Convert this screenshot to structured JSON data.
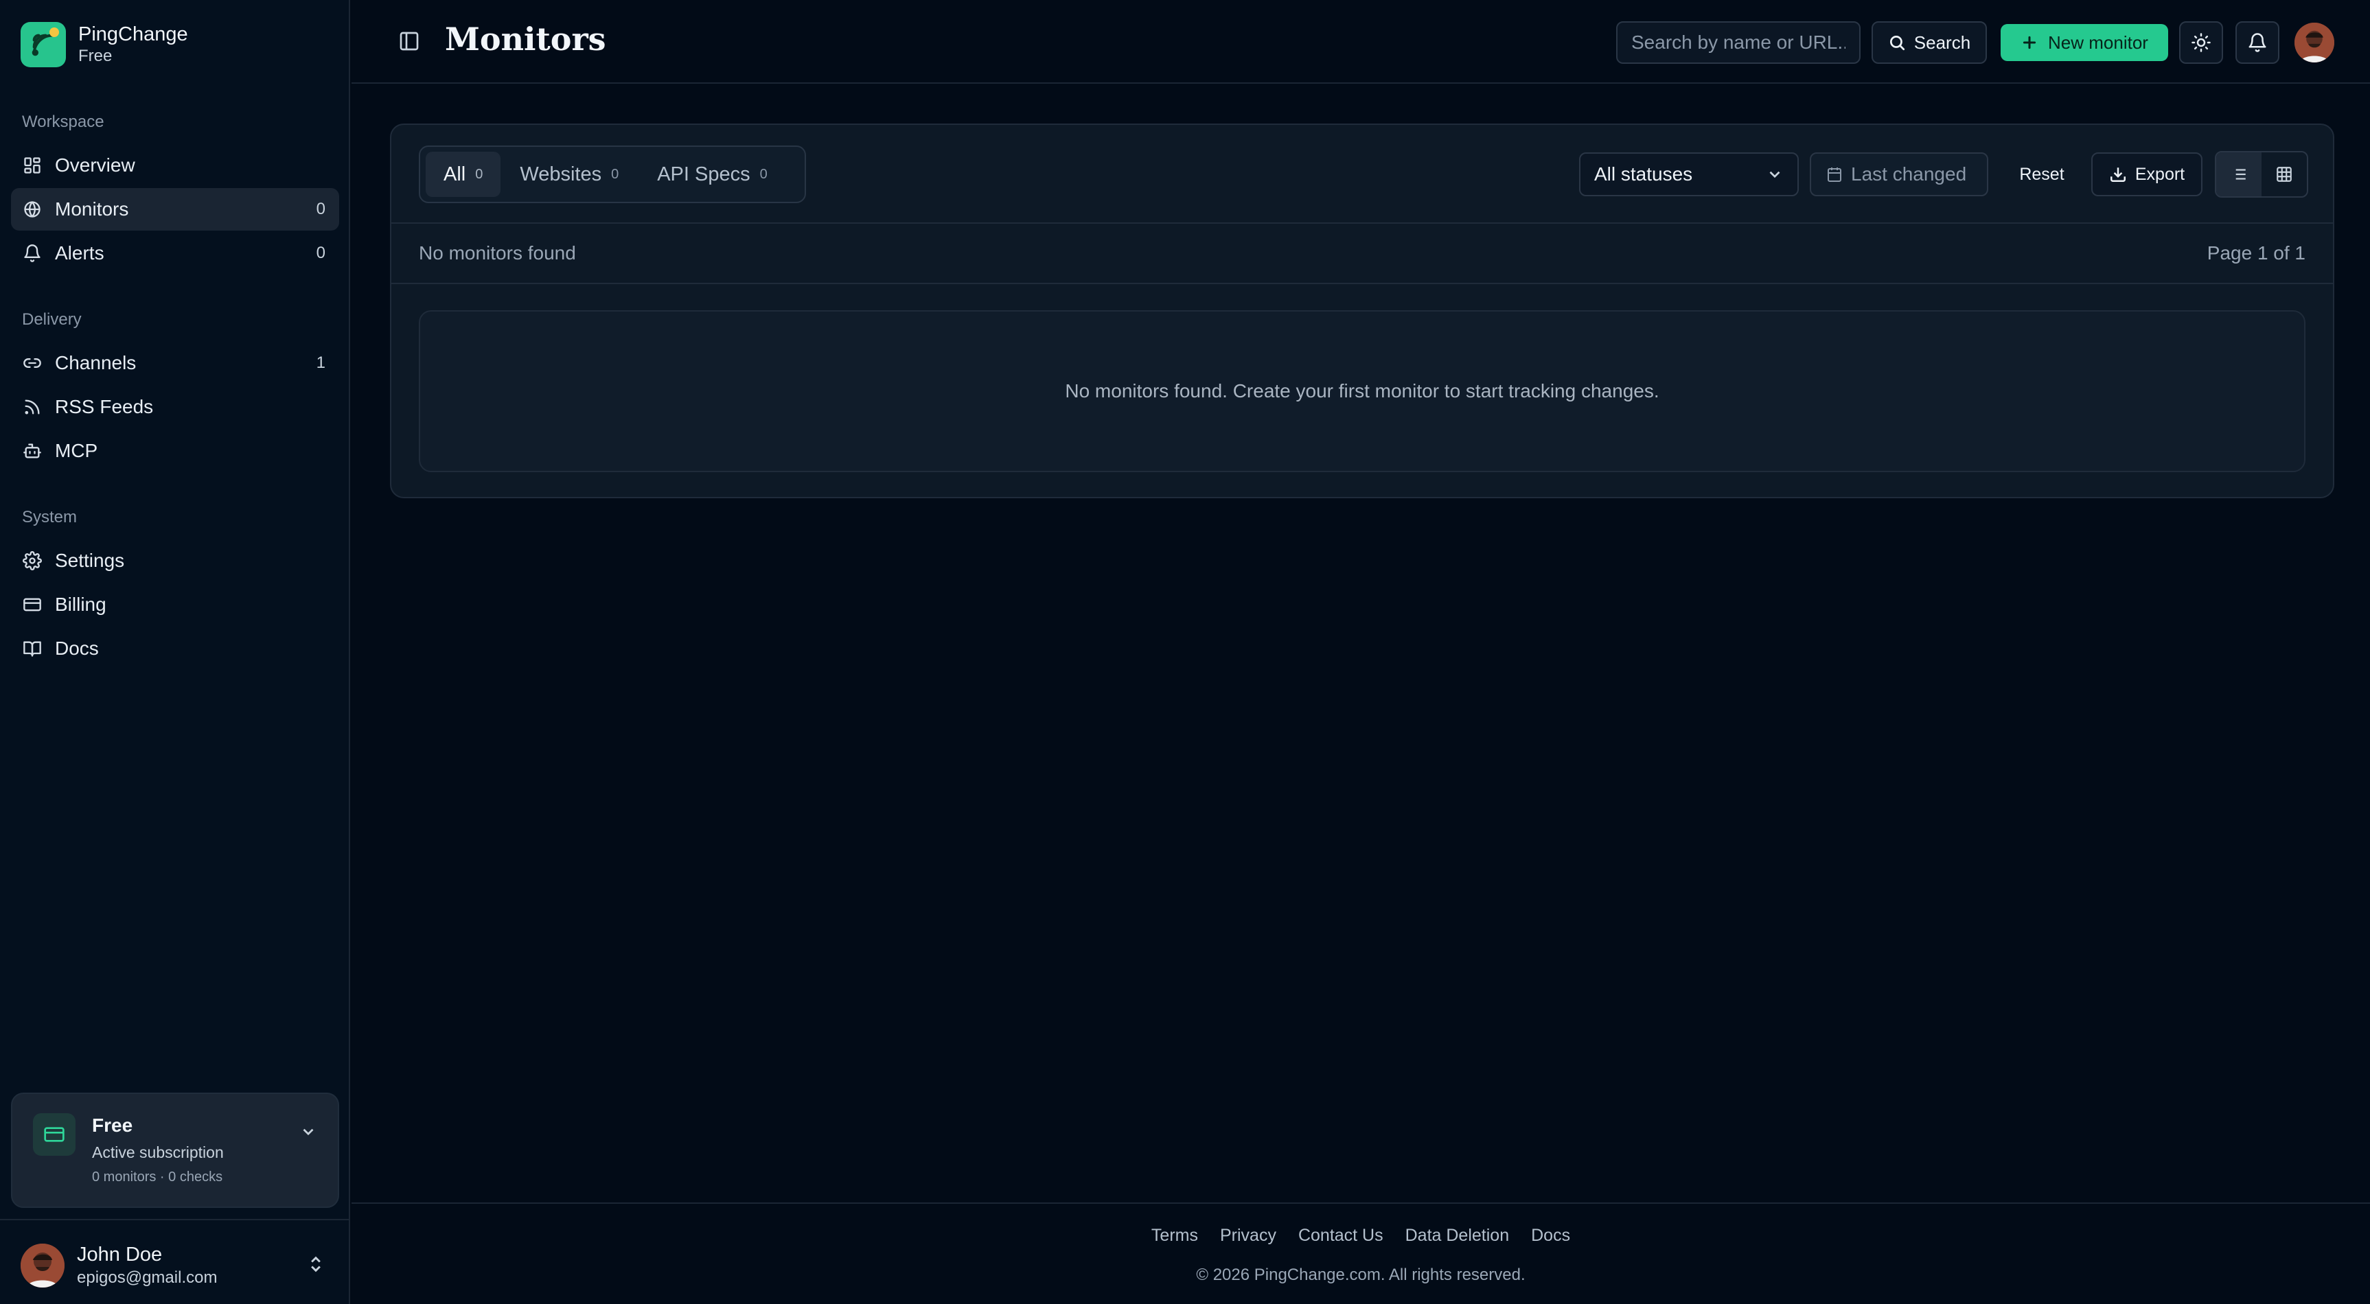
{
  "brand": {
    "name": "PingChange",
    "plan": "Free"
  },
  "sidebar": {
    "sections": [
      {
        "label": "Workspace"
      },
      {
        "label": "Delivery"
      },
      {
        "label": "System"
      }
    ],
    "items": [
      {
        "label": "Overview",
        "icon": "dashboard-icon",
        "count": ""
      },
      {
        "label": "Monitors",
        "icon": "globe-icon",
        "count": "0",
        "active": true
      },
      {
        "label": "Alerts",
        "icon": "bell-icon",
        "count": "0"
      },
      {
        "label": "Channels",
        "icon": "link-icon",
        "count": "1"
      },
      {
        "label": "RSS Feeds",
        "icon": "rss-icon",
        "count": ""
      },
      {
        "label": "MCP",
        "icon": "bot-icon",
        "count": ""
      },
      {
        "label": "Settings",
        "icon": "gear-icon",
        "count": ""
      },
      {
        "label": "Billing",
        "icon": "credit-card-icon",
        "count": ""
      },
      {
        "label": "Docs",
        "icon": "book-icon",
        "count": ""
      }
    ],
    "plan_card": {
      "title": "Free",
      "subtitle": "Active subscription",
      "meta": "0 monitors · 0 checks"
    },
    "user": {
      "name": "John Doe",
      "email": "epigos@gmail.com"
    }
  },
  "header": {
    "title": "Monitors",
    "search_placeholder": "Search by name or URL...",
    "search_label": "Search",
    "new_monitor_label": "New monitor"
  },
  "main": {
    "tabs": [
      {
        "label": "All",
        "count": "0",
        "active": true
      },
      {
        "label": "Websites",
        "count": "0"
      },
      {
        "label": "API Specs",
        "count": "0"
      }
    ],
    "status_filter": "All statuses",
    "date_filter": "Last changed",
    "reset_label": "Reset",
    "export_label": "Export",
    "summary": "No monitors found",
    "pagination": "Page 1 of 1",
    "empty_message": "No monitors found. Create your first monitor to start tracking changes."
  },
  "footer": {
    "links": [
      "Terms",
      "Privacy",
      "Contact Us",
      "Data Deletion",
      "Docs"
    ],
    "copyright": "© 2026 PingChange.com. All rights reserved."
  },
  "colors": {
    "accent": "#25c98f",
    "background": "#020b17",
    "sidebar": "#04101e",
    "card": "#0d1926"
  }
}
